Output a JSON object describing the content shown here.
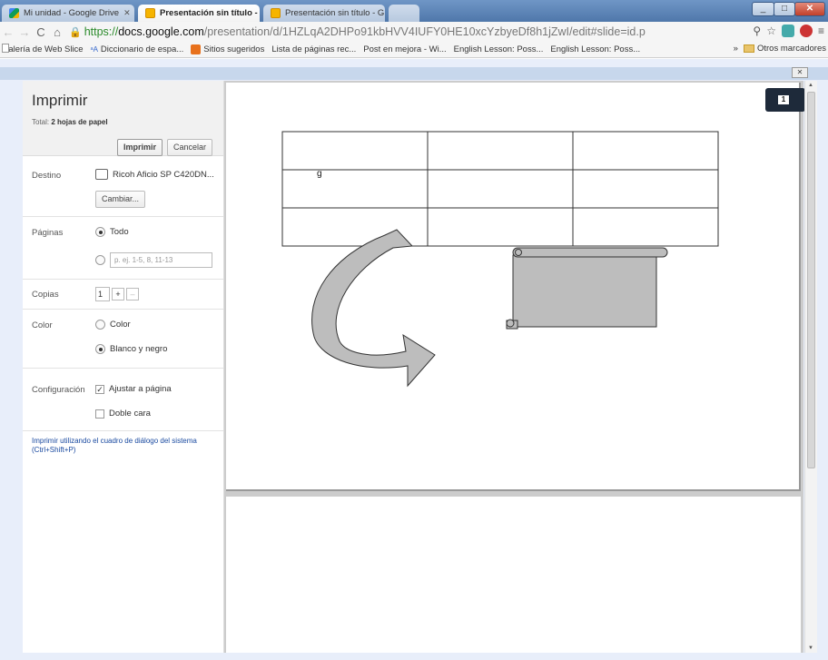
{
  "browser": {
    "tabs": [
      {
        "title": "Mi unidad - Google Drive",
        "icon": "drive-icon"
      },
      {
        "title": "Presentación sin título - G",
        "icon": "slides-icon"
      },
      {
        "title": "Presentación sin título - G",
        "icon": "slides-icon"
      }
    ],
    "url": {
      "scheme": "https://",
      "host": "docs.google.com",
      "path": "/presentation/d/1HZLqA2DHPo91kbHVV4IUFY0HE10xcYzbyeDf8h1jZwI/edit#slide=id.p"
    },
    "bookmarks": [
      "Galería de Web Slice",
      "Diccionario de espa...",
      "Sitios sugeridos",
      "Lista de páginas rec...",
      "Post en mejora - Wi...",
      "English Lesson: Poss...",
      "English Lesson: Poss..."
    ],
    "bookmark_overflow": "»",
    "other_bookmarks": "Otros marcadores"
  },
  "print": {
    "title": "Imprimir",
    "total_prefix": "Total:",
    "total_value": "2 hojas de papel",
    "print_button": "Imprimir",
    "cancel_button": "Cancelar",
    "destination": {
      "label": "Destino",
      "printer": "Ricoh Aficio SP C420DN...",
      "change_button": "Cambiar..."
    },
    "pages": {
      "label": "Páginas",
      "option_all": "Todo",
      "range_placeholder": "p. ej. 1-5, 8, 11-13"
    },
    "copies": {
      "label": "Copias",
      "value": "1",
      "plus": "+",
      "minus": "–"
    },
    "color": {
      "label": "Color",
      "option_color": "Color",
      "option_bw": "Blanco y negro"
    },
    "settings": {
      "label": "Configuración",
      "fit_to_page": "Ajustar a página",
      "two_sided": "Doble cara"
    },
    "system_dialog_link": "Imprimir utilizando el cuadro de diálogo del sistema (Ctrl+Shift+P)",
    "page_badge": "1",
    "slide_text": "g"
  },
  "dialog_close": "✕"
}
